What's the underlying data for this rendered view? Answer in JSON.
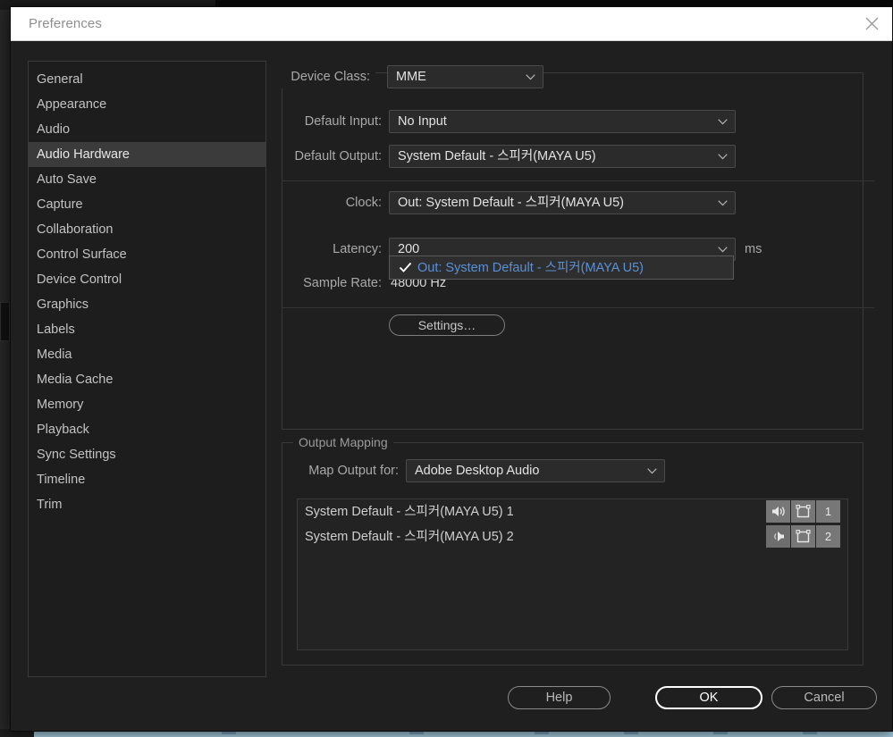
{
  "window": {
    "title": "Preferences",
    "close_icon": "close-icon"
  },
  "sidebar": {
    "items": [
      {
        "label": "General",
        "selected": false
      },
      {
        "label": "Appearance",
        "selected": false
      },
      {
        "label": "Audio",
        "selected": false
      },
      {
        "label": "Audio Hardware",
        "selected": true
      },
      {
        "label": "Auto Save",
        "selected": false
      },
      {
        "label": "Capture",
        "selected": false
      },
      {
        "label": "Collaboration",
        "selected": false
      },
      {
        "label": "Control Surface",
        "selected": false
      },
      {
        "label": "Device Control",
        "selected": false
      },
      {
        "label": "Graphics",
        "selected": false
      },
      {
        "label": "Labels",
        "selected": false
      },
      {
        "label": "Media",
        "selected": false
      },
      {
        "label": "Media Cache",
        "selected": false
      },
      {
        "label": "Memory",
        "selected": false
      },
      {
        "label": "Playback",
        "selected": false
      },
      {
        "label": "Sync Settings",
        "selected": false
      },
      {
        "label": "Timeline",
        "selected": false
      },
      {
        "label": "Trim",
        "selected": false
      }
    ]
  },
  "device_section": {
    "device_class_label": "Device Class:",
    "device_class_value": "MME",
    "default_input_label": "Default Input:",
    "default_input_value": "No Input",
    "default_output_label": "Default Output:",
    "default_output_value": "System Default - 스피커(MAYA U5)",
    "clock_label": "Clock:",
    "clock_value": "Out: System Default - 스피커(MAYA U5)",
    "latency_label": "Latency:",
    "latency_value": "200",
    "latency_unit": "ms",
    "sample_rate_label": "Sample Rate:",
    "sample_rate_value": "48000 Hz",
    "settings_button": "Settings…"
  },
  "clock_dropdown": {
    "open": true,
    "checkmark_icon": "check-icon",
    "options": [
      {
        "label": "Out: System Default - 스피커(MAYA U5)",
        "checked": true
      }
    ],
    "highlight_color": "#5b8fd6"
  },
  "output_mapping": {
    "legend": "Output Mapping",
    "map_output_label": "Map Output for:",
    "map_output_value": "Adobe Desktop Audio",
    "rows": [
      {
        "label": "System Default - 스피커(MAYA U5) 1",
        "speaker_icon": "speaker-left-icon",
        "bracket_icon": "channel-bracket-icon",
        "channel": "1"
      },
      {
        "label": "System Default - 스피커(MAYA U5) 2",
        "speaker_icon": "speaker-right-icon",
        "bracket_icon": "channel-bracket-icon",
        "channel": "2"
      }
    ]
  },
  "footer": {
    "help_label": "Help",
    "ok_label": "OK",
    "cancel_label": "Cancel"
  }
}
